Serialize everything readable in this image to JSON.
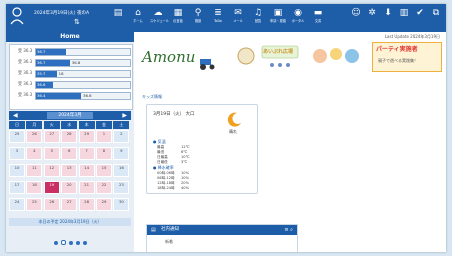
{
  "topbar": {
    "user_date": "2024年3月19日(火) 夜のA",
    "buttons": [
      {
        "label": "",
        "icon": "document-icon",
        "glyph": "▤"
      },
      {
        "label": "ホーム",
        "icon": "home-icon",
        "glyph": "⌂"
      },
      {
        "label": "スケジュール",
        "icon": "chat-icon",
        "glyph": "☁"
      },
      {
        "label": "伝言板",
        "icon": "calendar-icon",
        "glyph": "▦"
      },
      {
        "label": "施設",
        "icon": "pin-icon",
        "glyph": "⚲"
      },
      {
        "label": "ToDo",
        "icon": "list-icon",
        "glyph": "≣"
      },
      {
        "label": "メール",
        "icon": "mail-icon",
        "glyph": "✉"
      },
      {
        "label": "回覧",
        "icon": "bell-icon",
        "glyph": "♫"
      },
      {
        "label": "申請・稟議",
        "icon": "grid-icon",
        "glyph": "▣"
      },
      {
        "label": "ポータル",
        "icon": "globe-icon",
        "glyph": "◉"
      },
      {
        "label": "文書",
        "icon": "folder-icon",
        "glyph": "▬"
      },
      {
        "label": "",
        "icon": "user-settings-icon",
        "glyph": "☺"
      },
      {
        "label": "",
        "icon": "gear-icon",
        "glyph": "✲"
      },
      {
        "label": "",
        "icon": "download-icon",
        "glyph": "⬇"
      },
      {
        "label": "",
        "icon": "clipboard-icon",
        "glyph": "▥"
      },
      {
        "label": "",
        "icon": "check-icon",
        "glyph": "✔"
      },
      {
        "label": "",
        "icon": "network-icon",
        "glyph": "⧉"
      }
    ]
  },
  "sidebar": {
    "title": "Home",
    "meters": [
      {
        "label": "受 36.3",
        "fill": 0.32,
        "text": "36.7",
        "num": ""
      },
      {
        "label": "受 36.3",
        "fill": 0.36,
        "text": "36.7",
        "num": "36.8"
      },
      {
        "label": "受 36.3",
        "fill": 0.22,
        "text": "35.7",
        "num": "18"
      },
      {
        "label": "受 36.3",
        "fill": 0.18,
        "text": "36.6",
        "num": ""
      },
      {
        "label": "受 36.3",
        "fill": 0.48,
        "text": "36.4",
        "num": "36.6"
      }
    ],
    "tools": "⚙ ⇅"
  },
  "calendar": {
    "month": "2024年3月",
    "dow": [
      "日",
      "月",
      "火",
      "水",
      "木",
      "金",
      "土"
    ],
    "cells": [
      "25",
      "26",
      "27",
      "28",
      "29",
      "1",
      "2",
      "3",
      "4",
      "5",
      "6",
      "7",
      "8",
      "9",
      "10",
      "11",
      "12",
      "13",
      "14",
      "15",
      "16",
      "17",
      "18",
      "19",
      "20",
      "21",
      "22",
      "23",
      "24",
      "25",
      "26",
      "27",
      "28",
      "29",
      "30"
    ],
    "today_index": 23,
    "note": "本日の予定 2024年3月19日（火）"
  },
  "main": {
    "welcome": "Last Update 2024年3月19日",
    "logo": "Amonu",
    "banner1_title": "あいぷれ広場",
    "banner3_title": "パーティ実施者",
    "banner3_sub": "親子で遊べる実践集！",
    "section": "キッズ情報"
  },
  "weather": {
    "date": "3月19日（火）",
    "place": "大口",
    "moon_label": "晴れ",
    "sec1": "● 気温",
    "rows1": [
      {
        "k": "最高",
        "v": "12℃"
      },
      {
        "k": "最低",
        "v": "6℃"
      },
      {
        "k": "日最高",
        "v": "10℃"
      },
      {
        "k": "日最低",
        "v": "3℃"
      }
    ],
    "sec2": "● 降水確率",
    "rows2": [
      {
        "k": "00時-06時",
        "v": "10%"
      },
      {
        "k": "06時-12時",
        "v": "10%"
      },
      {
        "k": "12時-18時",
        "v": "20%"
      },
      {
        "k": "18時-24時",
        "v": "40%"
      }
    ]
  },
  "notice": {
    "title": "社内通知",
    "row": "新着"
  }
}
